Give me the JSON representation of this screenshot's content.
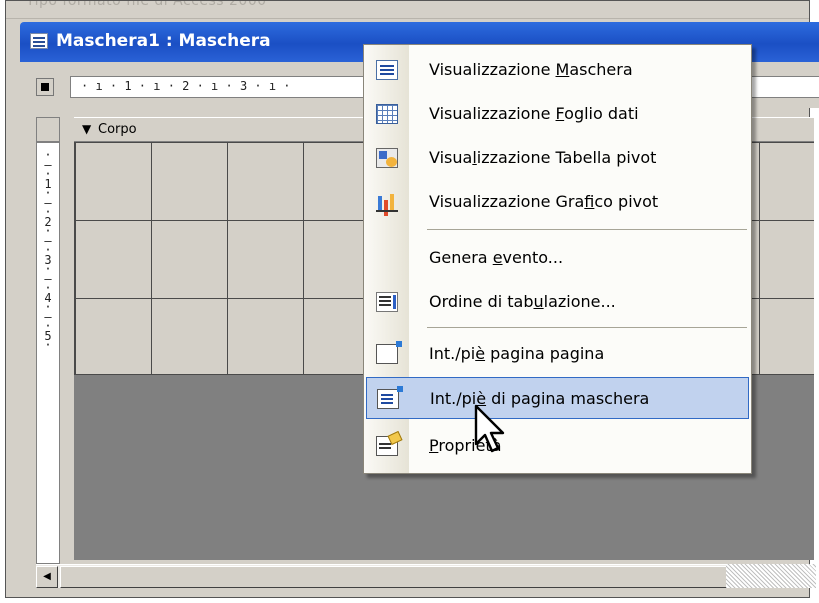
{
  "background_text": "Tipo formato file di Access 2000",
  "window": {
    "title": "Maschera1 : Maschera",
    "title_icon": "form-icon"
  },
  "ruler": {
    "horizontal": "· ı · 1 · ı · 2 · ı · 3 · ı ·                                                      9 · ı ·",
    "vertical": "·\n–\n·\n1\n·\n–\n·\n2\n·\n–\n·\n3\n·\n–\n·\n4\n·\n–\n·\n5\n·"
  },
  "section": {
    "label": "Corpo",
    "arrow": "▼"
  },
  "context_menu": {
    "items": [
      {
        "pre": "Visualizzazione ",
        "key": "M",
        "post": "aschera",
        "icon": "form-view-icon"
      },
      {
        "pre": "Visualizzazione ",
        "key": "F",
        "post": "oglio dati",
        "icon": "datasheet-icon"
      },
      {
        "pre": "Visua",
        "key": "l",
        "post": "izzazione Tabella pivot",
        "icon": "pivot-table-icon"
      },
      {
        "pre": "Visualizzazione Gra",
        "key": "f",
        "post": "ico pivot",
        "icon": "pivot-chart-icon"
      },
      {
        "pre": "Genera ",
        "key": "e",
        "post": "vento...",
        "icon": ""
      },
      {
        "pre": "Ordine di tab",
        "key": "u",
        "post": "lazione...",
        "icon": "tab-order-icon"
      },
      {
        "pre": "Int./pi",
        "key": "è",
        "post": " pagina pagina",
        "icon": "page-header-footer-icon"
      },
      {
        "pre": "Int./pi",
        "key": "è",
        "post": " di pagina maschera",
        "icon": "form-header-footer-icon"
      },
      {
        "pre": "",
        "key": "P",
        "post": "roprietà",
        "icon": "properties-icon"
      }
    ],
    "highlighted_index": 7
  },
  "colors": {
    "title_bar": "#1b4fc4",
    "highlight": "#c1d2ee",
    "highlight_border": "#316ac5"
  }
}
